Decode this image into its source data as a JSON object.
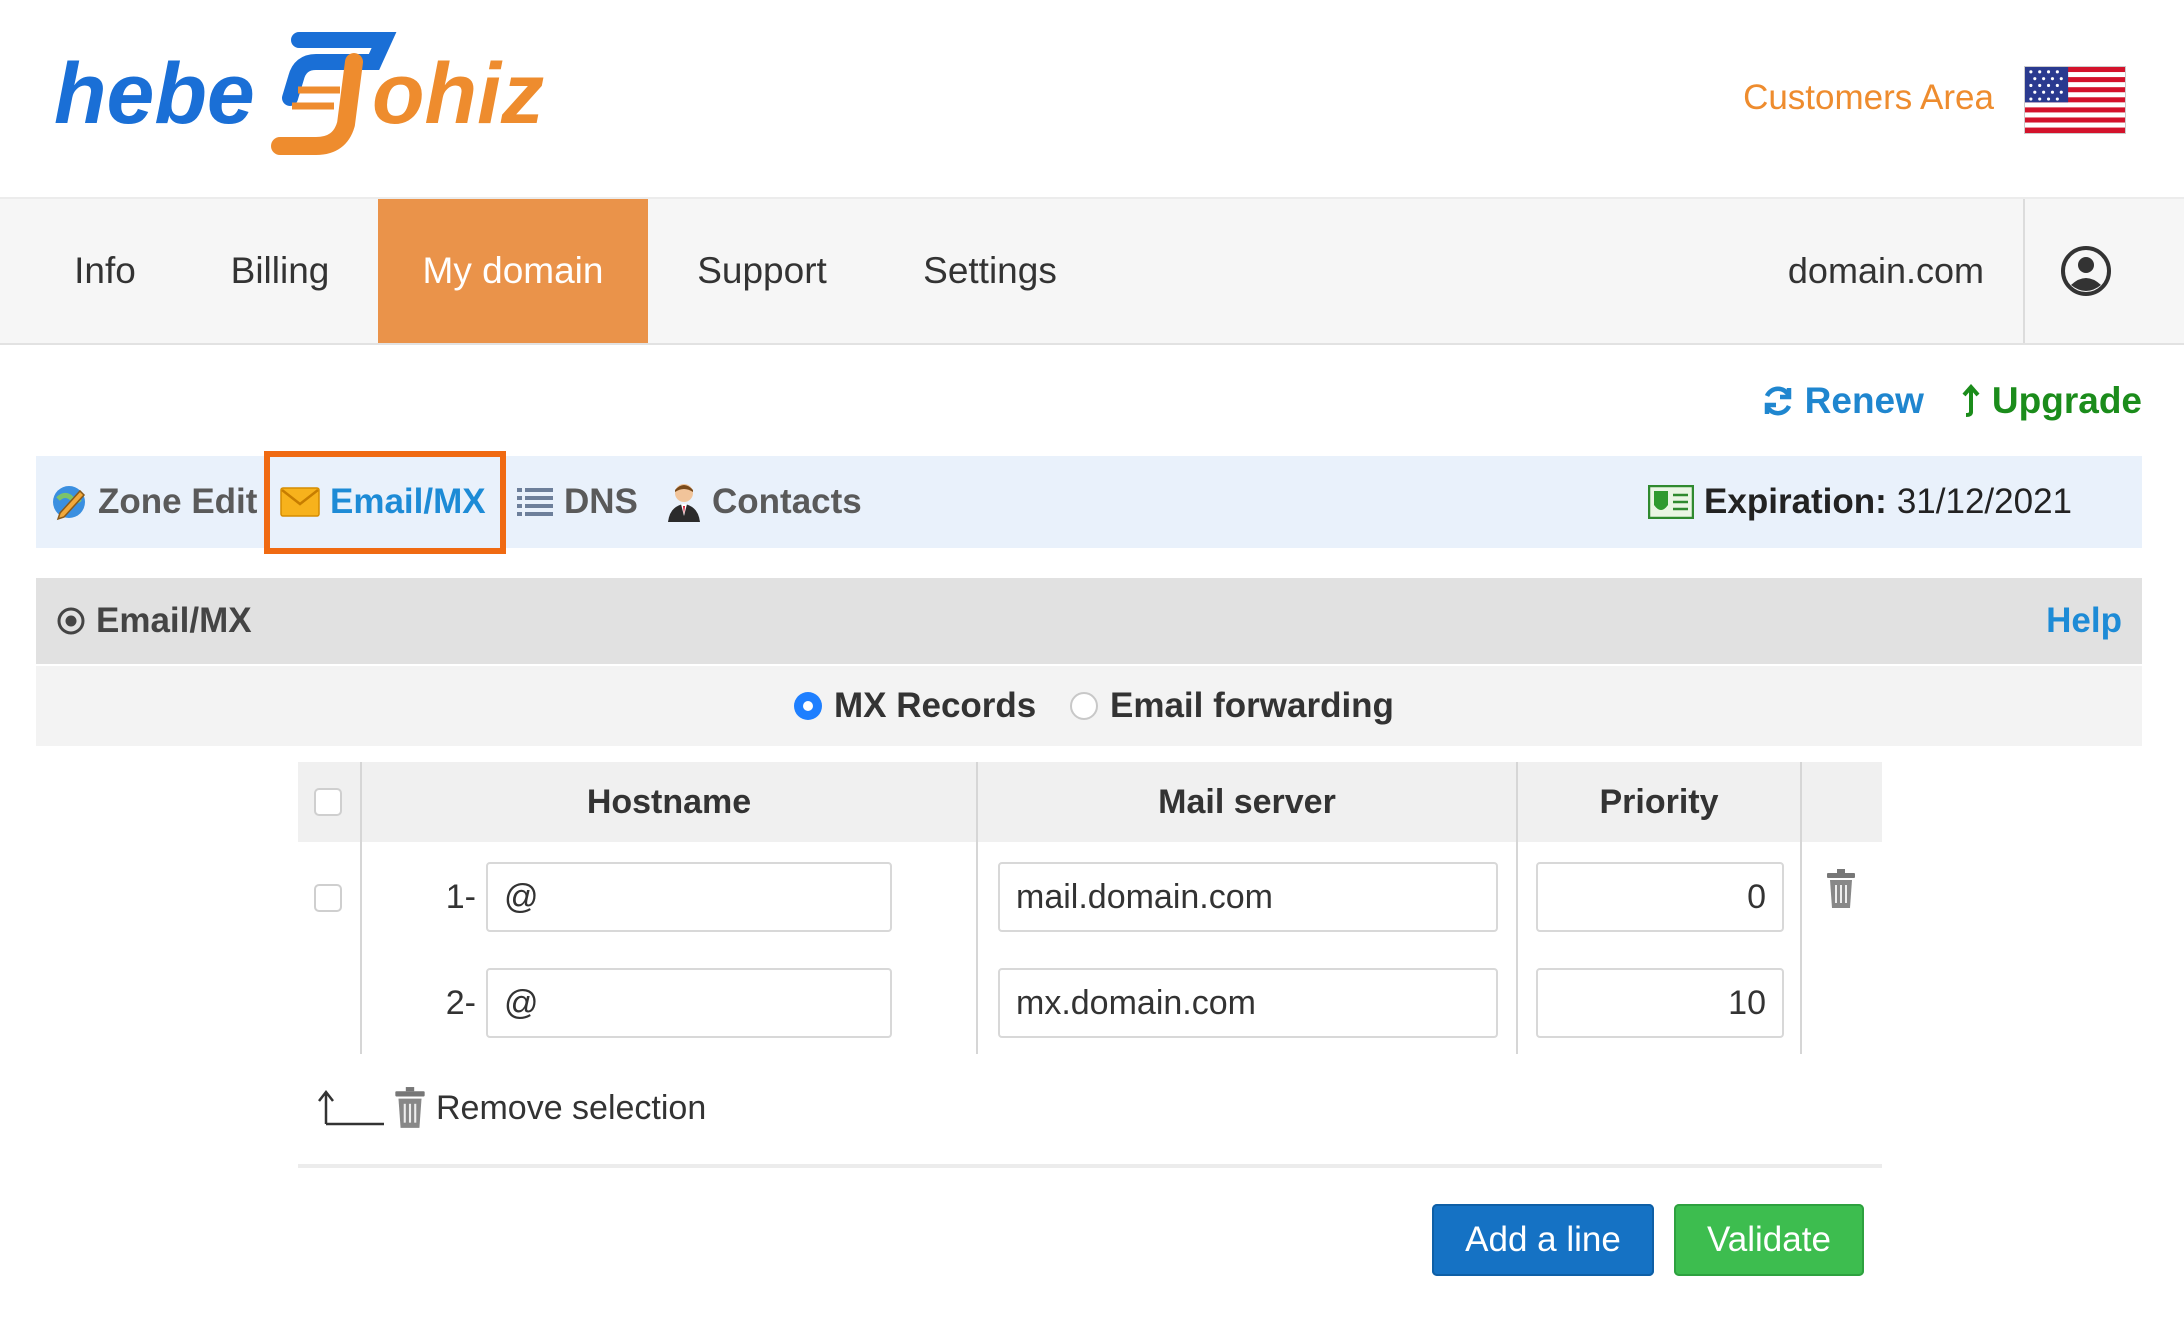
{
  "header": {
    "logo_text_left": "hebe",
    "logo_text_right": "ohiz",
    "customers_area": "Customers Area",
    "flag_icon": "us-flag-icon"
  },
  "nav": {
    "items": [
      {
        "label": "Info",
        "active": false
      },
      {
        "label": "Billing",
        "active": false
      },
      {
        "label": "My domain",
        "active": true
      },
      {
        "label": "Support",
        "active": false
      },
      {
        "label": "Settings",
        "active": false
      }
    ],
    "domain": "domain.com",
    "user_icon": "user-circle-icon"
  },
  "actions": {
    "renew": "Renew",
    "upgrade": "Upgrade"
  },
  "tabs": {
    "items": [
      {
        "label": "Zone Edit",
        "icon": "zone-edit-icon"
      },
      {
        "label": "Email/MX",
        "icon": "envelope-icon",
        "active": true
      },
      {
        "label": "DNS",
        "icon": "list-icon"
      },
      {
        "label": "Contacts",
        "icon": "person-icon"
      }
    ],
    "expiration_label": "Expiration:",
    "expiration_value": "31/12/2021"
  },
  "section": {
    "title": "Email/MX",
    "help": "Help",
    "radio_options": [
      {
        "label": "MX Records",
        "selected": true
      },
      {
        "label": "Email forwarding",
        "selected": false
      }
    ]
  },
  "table": {
    "headers": [
      "Hostname",
      "Mail server",
      "Priority"
    ],
    "rows": [
      {
        "num": "1-",
        "hostname": "@",
        "mail_server": "mail.domain.com",
        "priority": "0"
      },
      {
        "num": "2-",
        "hostname": "@",
        "mail_server": "mx.domain.com",
        "priority": "10"
      }
    ],
    "remove_selection": "Remove selection"
  },
  "buttons": {
    "add_line": "Add a line",
    "validate": "Validate"
  },
  "colors": {
    "accent_orange": "#ea934a",
    "link_blue": "#1d8bd6",
    "upgrade_green": "#1b8c1b",
    "add_button": "#1572c4",
    "validate_button": "#3dbd4f",
    "highlight_box": "#f06a12"
  }
}
